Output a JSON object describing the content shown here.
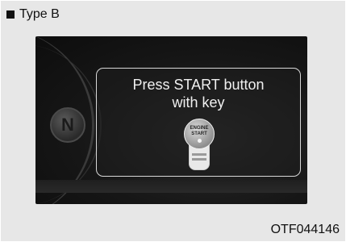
{
  "header": {
    "type_label": "Type B"
  },
  "cluster": {
    "gear_indicator": "N",
    "message_line1": "Press START button",
    "message_line2": "with key",
    "button_text_line1": "ENGINE",
    "button_text_line2": "START"
  },
  "figure_code": "OTF044146",
  "colors": {
    "page_bg": "#e7e7e7",
    "display_bg": "#161616",
    "panel_border": "#d8d8d8",
    "text_light": "#f0f0f0"
  },
  "icons": {
    "bullet": "square-bullet-icon",
    "key_fob": "key-fob-icon",
    "engine_start": "engine-start-button-icon"
  }
}
